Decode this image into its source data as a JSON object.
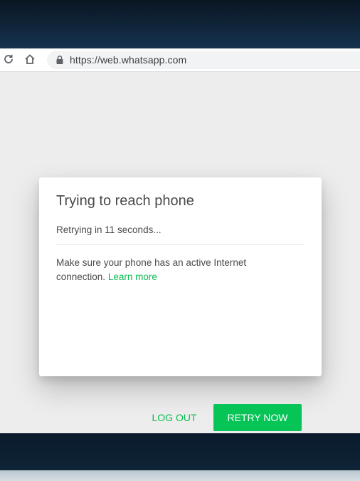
{
  "browser": {
    "url": "https://web.whatsapp.com",
    "icons": {
      "reload": "reload-icon",
      "home": "home-icon",
      "lock": "lock-icon"
    }
  },
  "dialog": {
    "title": "Trying to reach phone",
    "status": "Retrying in 11 seconds...",
    "body_text": "Make sure your phone has an active Internet connection.",
    "learn_more": "Learn more",
    "logout_label": "LOG OUT",
    "retry_label": "RETRY NOW"
  },
  "colors": {
    "accent": "#07bc4c",
    "retry_button": "#07c457",
    "page_background": "#ededed",
    "desktop_background": "#0d1b2b"
  }
}
